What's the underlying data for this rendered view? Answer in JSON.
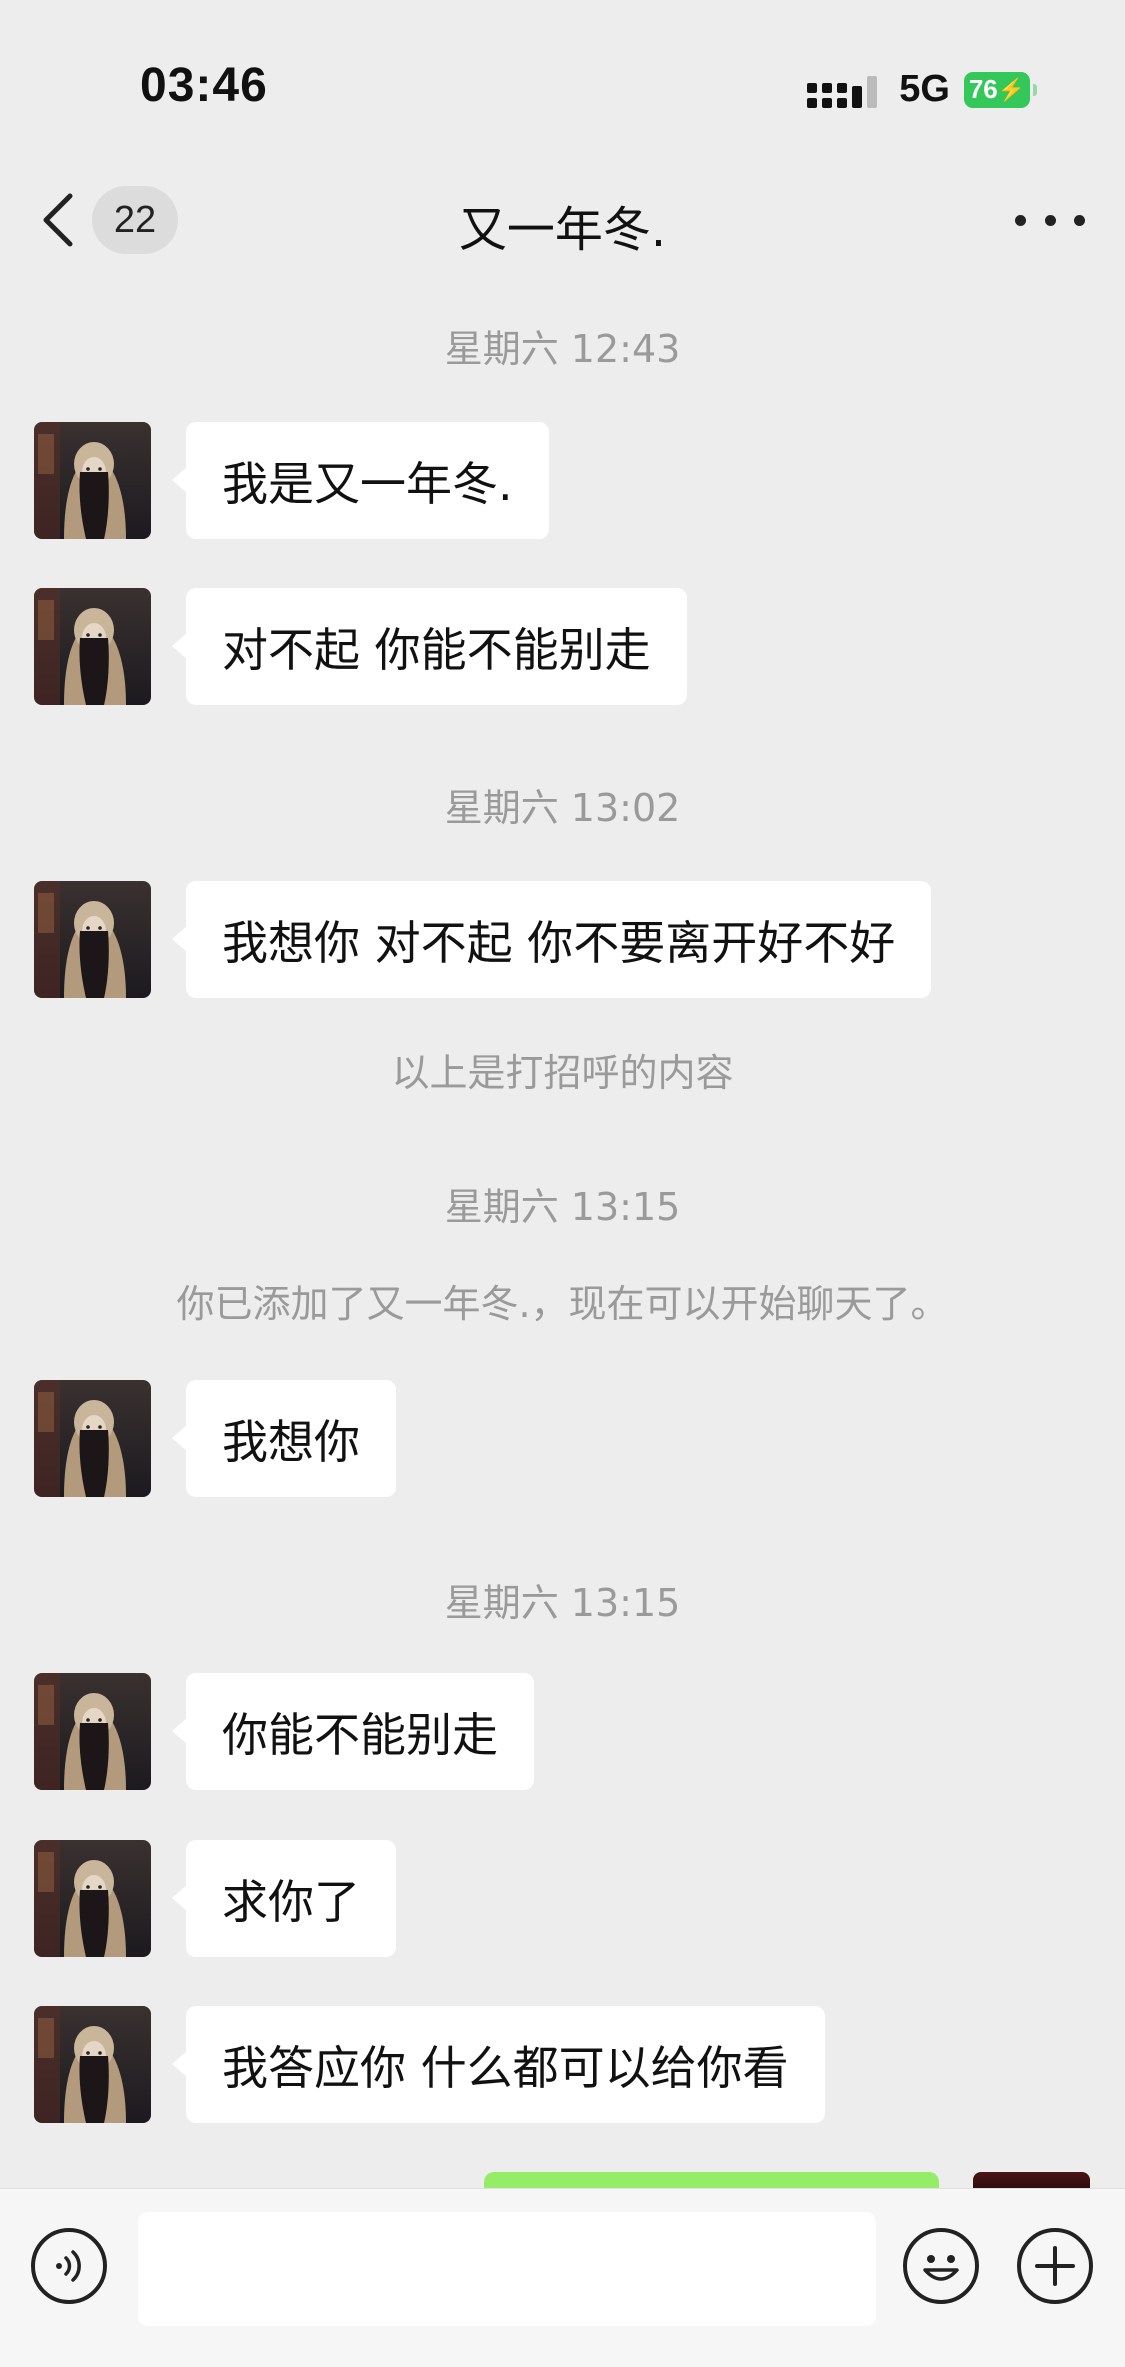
{
  "status_bar": {
    "time": "03:46",
    "network": "5G",
    "battery": "76"
  },
  "nav": {
    "back_count": "22",
    "title": "又一年冬."
  },
  "chat": {
    "timestamps": [
      "星期六 12:43",
      "星期六 13:02",
      "星期六 13:15",
      "星期六 13:15"
    ],
    "system_notes": [
      "以上是打招呼的内容",
      "你已添加了又一年冬.，现在可以开始聊天了。"
    ],
    "messages": [
      "我是又一年冬.",
      "对不起 你能不能别走",
      "我想你 对不起 你不要离开好不好",
      "我想你",
      "你能不能别走",
      "求你了",
      "我答应你 什么都可以给你看"
    ]
  },
  "input": {
    "value": "",
    "placeholder": ""
  },
  "icons": [
    "back-chevron-icon",
    "more-dots-icon",
    "voice-icon",
    "emoji-icon",
    "plus-icon",
    "signal-icon",
    "battery-charging-icon"
  ],
  "colors": {
    "background": "#ededed",
    "bubble_incoming": "#ffffff",
    "bubble_outgoing": "#95ec69",
    "battery": "#34c759"
  }
}
